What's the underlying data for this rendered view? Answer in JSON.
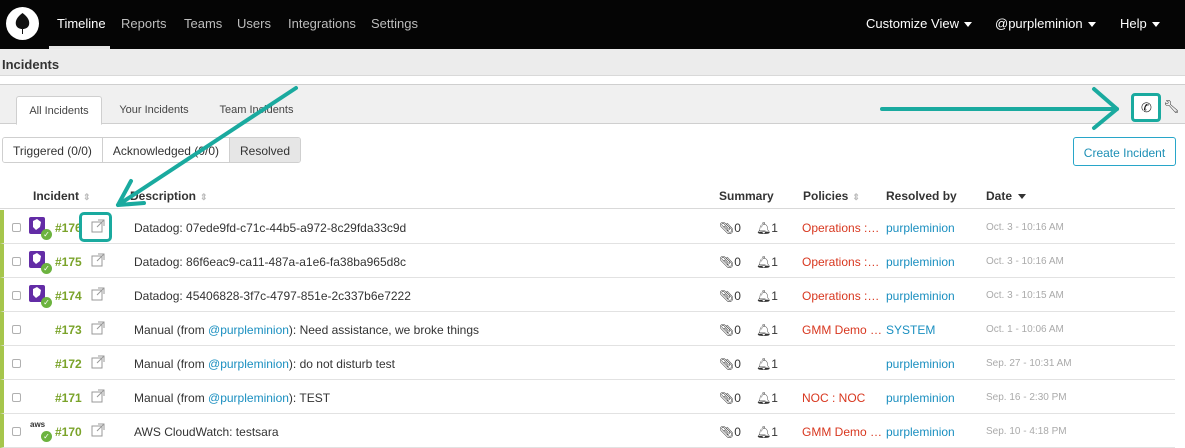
{
  "nav": {
    "items": [
      "Timeline",
      "Reports",
      "Teams",
      "Users",
      "Integrations",
      "Settings"
    ],
    "right": [
      "Customize View",
      "@purpleminion",
      "Help"
    ]
  },
  "section_title": "Incidents",
  "tabs": [
    "All Incidents",
    "Your Incidents",
    "Team Incidents"
  ],
  "filters": [
    "Triggered (0/0)",
    "Acknowledged (0/0)",
    "Resolved"
  ],
  "create_button": "Create Incident",
  "table": {
    "headers": [
      "Incident",
      "Description",
      "Summary",
      "Policies",
      "Resolved by",
      "Date"
    ],
    "rows": [
      {
        "num": "#176",
        "desc": "Datadog: 07ede9fd-c71c-44b5-a972-8c29fda33c9d",
        "att": "0",
        "bell": "1",
        "policy": "Operations :…",
        "resolved": "purpleminion",
        "date": "Oct. 3 - 10:16 AM",
        "source": "datadog"
      },
      {
        "num": "#175",
        "desc": "Datadog: 86f6eac9-ca11-487a-a1e6-fa38ba965d8c",
        "att": "0",
        "bell": "1",
        "policy": "Operations :…",
        "resolved": "purpleminion",
        "date": "Oct. 3 - 10:16 AM",
        "source": "datadog"
      },
      {
        "num": "#174",
        "desc": "Datadog: 45406828-3f7c-4797-851e-2c337b6e7222",
        "att": "0",
        "bell": "1",
        "policy": "Operations :…",
        "resolved": "purpleminion",
        "date": "Oct. 3 - 10:15 AM",
        "source": "datadog"
      },
      {
        "num": "#173",
        "desc_prefix": "Manual  (from ",
        "desc_user": "@purpleminion",
        "desc_suffix": "): Need assistance, we broke things",
        "att": "0",
        "bell": "1",
        "policy": "GMM Demo …",
        "resolved": "SYSTEM",
        "date": "Oct. 1 - 10:06 AM",
        "source": "manual"
      },
      {
        "num": "#172",
        "desc_prefix": "Manual  (from ",
        "desc_user": "@purpleminion",
        "desc_suffix": "): do not disturb test",
        "att": "0",
        "bell": "1",
        "policy": "",
        "resolved": "purpleminion",
        "date": "Sep. 27 - 10:31 AM",
        "source": "manual"
      },
      {
        "num": "#171",
        "desc_prefix": "Manual  (from ",
        "desc_user": "@purpleminion",
        "desc_suffix": "): TEST",
        "att": "0",
        "bell": "1",
        "policy": "NOC : NOC",
        "resolved": "purpleminion",
        "date": "Sep. 16 - 2:30 PM",
        "source": "manual"
      },
      {
        "num": "#170",
        "desc": "AWS CloudWatch: testsara",
        "att": "0",
        "bell": "1",
        "policy": "GMM Demo …",
        "resolved": "purpleminion",
        "date": "Sep. 10 - 4:18 PM",
        "source": "aws"
      }
    ]
  },
  "colors": {
    "accent_teal": "#1aaa9f",
    "incident_green": "#7aa32a",
    "policy_red": "#d8371f",
    "link_blue": "#1a8fc0"
  },
  "icons": {
    "logo": "leaf-logo-icon",
    "phone": "phone-icon",
    "wrench": "wrench-icon",
    "external": "external-link-icon",
    "attachment": "paperclip-icon",
    "bell": "bell-icon"
  }
}
